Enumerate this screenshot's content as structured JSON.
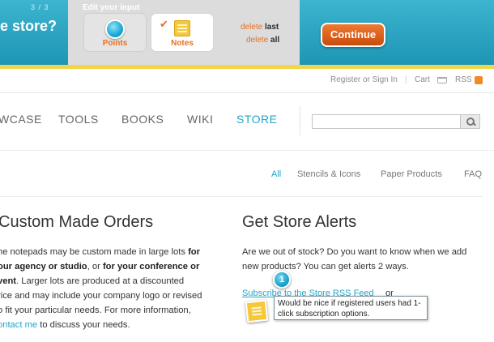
{
  "toolbar": {
    "step": "3 / 3",
    "question": "e store?",
    "input_title": "Edit your input",
    "options": [
      {
        "label": "Points",
        "icon": "point-dot-icon"
      },
      {
        "label": "Notes",
        "icon": "note-icon"
      }
    ],
    "delete_last": {
      "prefix": "delete ",
      "bold": "last"
    },
    "delete_all": {
      "prefix": "delete ",
      "bold": "all"
    },
    "continue_label": "Continue",
    "accent_color": "#1d95b4",
    "button_color": "#e2621a"
  },
  "utility_nav": {
    "register": "Register or Sign In",
    "separator": "|",
    "cart": "Cart",
    "rss": "RSS"
  },
  "main_nav": {
    "items": [
      "WCASE",
      "TOOLS",
      "BOOKS",
      "WIKI",
      "STORE"
    ],
    "active": "STORE"
  },
  "search": {
    "placeholder": ""
  },
  "sub_nav": {
    "items": [
      "All",
      "Stencils & Icons",
      "Paper Products",
      "FAQ"
    ],
    "active": "All"
  },
  "left_column": {
    "title": "Custom Made Orders",
    "p1": "he notepads may be custom made in large lots ",
    "b1": "for",
    "b2": "our agency or studio",
    "p2": ", or ",
    "b3": "for your conference or",
    "b4": "vent",
    "p3": ". Larger lots are produced at a discounted",
    "p4": "rice and may include your company logo or revised",
    "p5": "o fit your particular needs. For more information,",
    "link": "ontact me",
    "p6": " to discuss your needs."
  },
  "right_column": {
    "title": "Get Store Alerts",
    "body": "Are we out of stock? Do you want to know when we add new products? You can get alerts 2 ways.",
    "rss_link": "Subscribe to the Store RSS Feed",
    "or": "or"
  },
  "annotation": {
    "marker_number": "1",
    "note_text": "Would be nice if registered users had 1-click subscription options."
  }
}
